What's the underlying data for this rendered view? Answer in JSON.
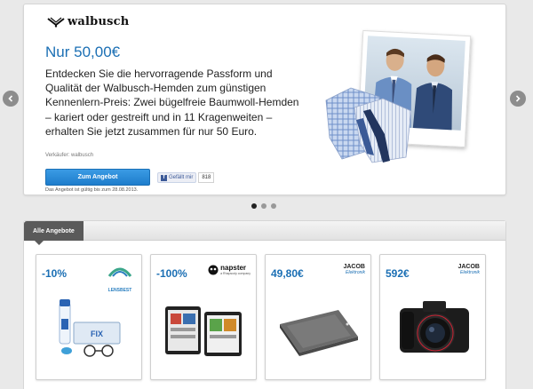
{
  "hero": {
    "brand": "walbusch",
    "price": "Nur 50,00€",
    "description": "Entdecken Sie die hervorragende Passform und Qualität der Walbusch-Hemden zum günstigen Kennenlern-Preis: Zwei bügelfreie Baumwoll-Hemden – kariert oder gestreift und in 11 Kragenweiten – erhalten Sie jetzt zusammen für nur 50 Euro.",
    "seller": "Verkäufer: walbusch",
    "cta_label": "Zum Angebot",
    "fb_like_label": "Gefällt mir",
    "fb_like_count": "818",
    "validity": "Das Angebot ist gültig bis zum 28.08.2013."
  },
  "carousel": {
    "prev_icon": "chevron-left-icon",
    "next_icon": "chevron-right-icon",
    "slides": 3,
    "active_slide": 1
  },
  "offers": {
    "tab_label": "Alle Angebote",
    "cards": [
      {
        "badge": "-10%",
        "partner": "LENSBEST",
        "product": "contact-lens-care-set"
      },
      {
        "badge": "-100%",
        "partner": "napster",
        "partner_sub": "a Rhapsody company",
        "product": "music-streaming-devices"
      },
      {
        "badge": "49,80€",
        "partner": "JACOB",
        "partner_sub": "Elektronik",
        "product": "card-reader-device"
      },
      {
        "badge": "592€",
        "partner": "JACOB",
        "partner_sub": "Elektronik",
        "product": "canon-dslr-camera"
      }
    ]
  },
  "colors": {
    "accent_blue": "#1b6fb4",
    "button_blue": "#2a8ad8",
    "tab_dark": "#5a5a5a",
    "page_bg": "#e9e9e9"
  }
}
